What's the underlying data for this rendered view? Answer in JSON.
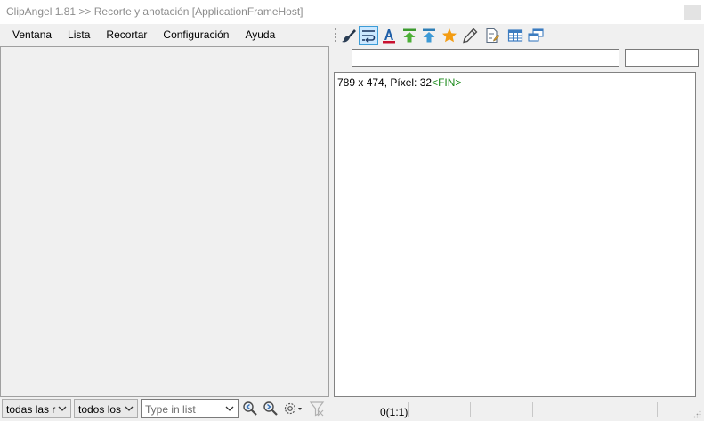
{
  "window": {
    "title": "ClipAngel 1.81 >> Recorte y anotación [ApplicationFrameHost]"
  },
  "menu": {
    "items": [
      "Ventana",
      "Lista",
      "Recortar",
      "Configuración",
      "Ayuda"
    ]
  },
  "toolbar": {
    "icons": [
      "brush-icon",
      "word-wrap-icon",
      "text-color-icon",
      "move-up-icon",
      "move-top-icon",
      "favorite-star-icon",
      "edit-pencil-icon",
      "edit-note-icon",
      "table-icon",
      "windows-icon"
    ],
    "pressed": "word-wrap-icon"
  },
  "editor": {
    "info": "789 x 474, Píxel: 32",
    "end_marker": "<FIN>"
  },
  "filters": {
    "type_filter": "todas las r",
    "mark_filter": "todos los",
    "search_placeholder": "Type in list"
  },
  "status": {
    "position": "0(1:1)"
  },
  "colors": {
    "accent": "#3c9cd7",
    "pressed_bg": "#cce8ff",
    "end_marker": "#1a8a1a",
    "title_text": "#8c8c8c"
  }
}
